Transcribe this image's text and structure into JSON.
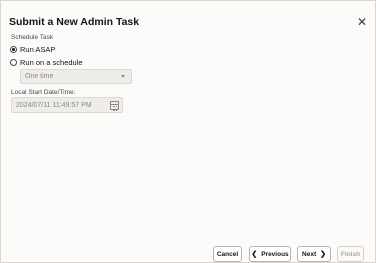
{
  "dialog": {
    "title": "Submit a New Admin Task",
    "close_icon": "close-icon"
  },
  "schedule": {
    "section_label": "Schedule Task",
    "options": [
      {
        "label": "Run ASAP",
        "checked": true
      },
      {
        "label": "Run on a schedule",
        "checked": false
      }
    ],
    "frequency": {
      "value": "One time"
    }
  },
  "start": {
    "label": "Local Start Date/Time:",
    "placeholder": "2024/07/11 11:49:57 PM",
    "icon": "calendar-icon"
  },
  "footer": {
    "cancel": "Cancel",
    "previous": "Previous",
    "next": "Next",
    "finish": "Finish",
    "previous_icon": "chevron-left-icon",
    "next_icon": "chevron-right-icon"
  }
}
